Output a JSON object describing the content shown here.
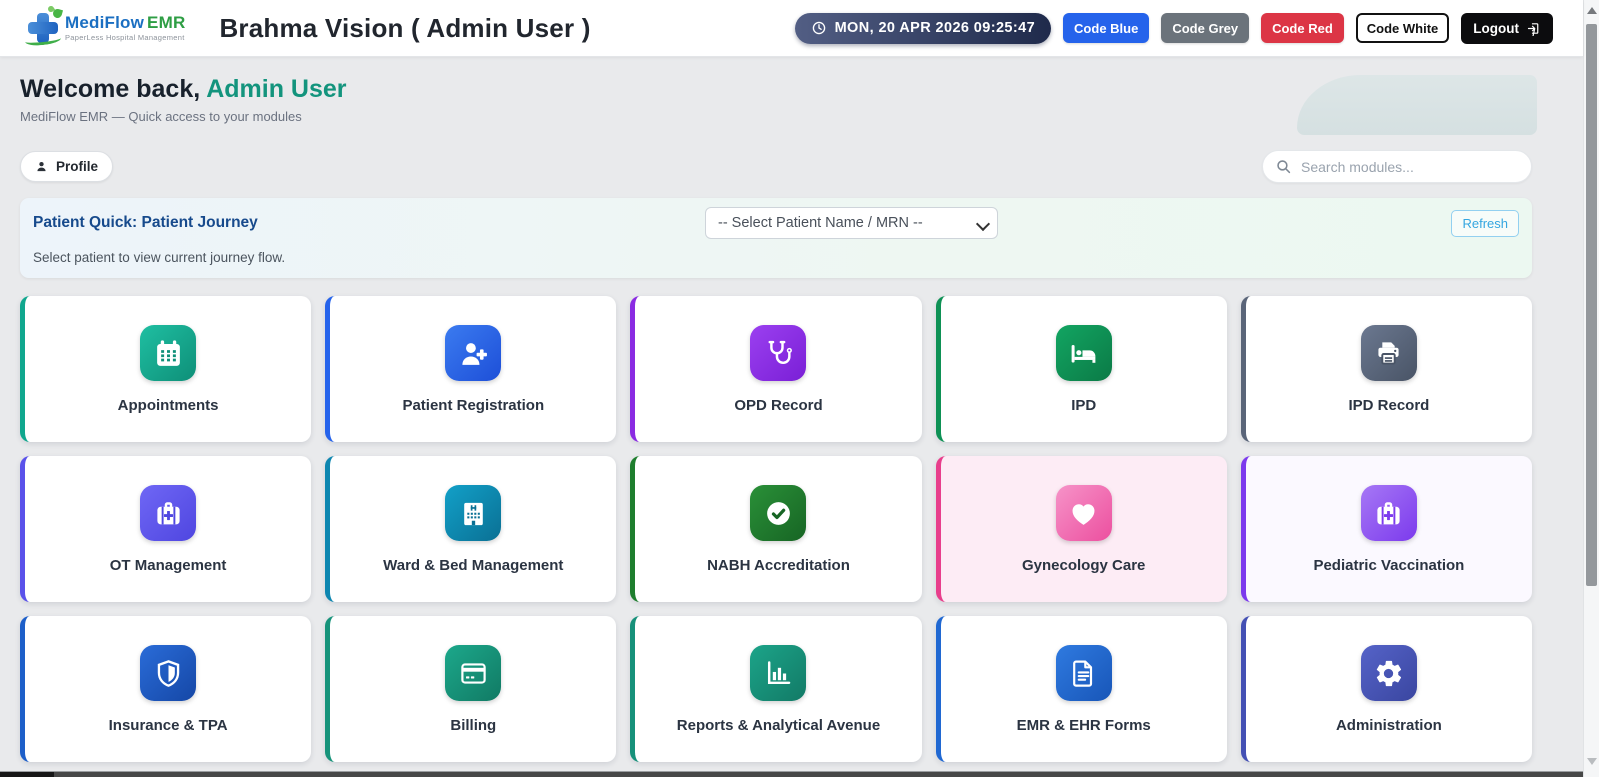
{
  "header": {
    "logo": {
      "brand_blue": "MediFlow",
      "brand_green": "EMR",
      "tagline": "PaperLess Hospital Management"
    },
    "title": "Brahma Vision ( Admin User )",
    "datetime": "MON, 20 APR 2026 09:25:47",
    "code_buttons": [
      {
        "label": "Code Blue",
        "bg": "#2563eb",
        "fg": "#ffffff"
      },
      {
        "label": "Code Grey",
        "bg": "#6b737b",
        "fg": "#ffffff"
      },
      {
        "label": "Code Red",
        "bg": "#dc3545",
        "fg": "#ffffff"
      },
      {
        "label": "Code White",
        "bg": "#ffffff",
        "fg": "#111111",
        "border": "#111111"
      }
    ],
    "logout_label": "Logout"
  },
  "welcome": {
    "greeting": "Welcome back,",
    "user": " Admin User",
    "user_color": "#13947d",
    "subtitle": "MediFlow EMR — Quick access to your modules"
  },
  "toolbar": {
    "profile_label": "Profile",
    "search_placeholder": "Search modules..."
  },
  "patient_quick": {
    "title": "Patient Quick: Patient Journey",
    "hint": "Select patient to view current journey flow.",
    "select_value": "-- Select Patient Name / MRN --",
    "refresh_label": "Refresh"
  },
  "modules": [
    {
      "label": "Appointments",
      "icon": "calendar-icon",
      "accent": "#10a78e",
      "tile_from": "#1fbfa2",
      "tile_to": "#0e8f78"
    },
    {
      "label": "Patient Registration",
      "icon": "user-plus-icon",
      "accent": "#2563eb",
      "tile_from": "#3b7bf0",
      "tile_to": "#1d4fd8"
    },
    {
      "label": "OPD Record",
      "icon": "stethoscope-icon",
      "accent": "#8a2be2",
      "tile_from": "#9b40f0",
      "tile_to": "#7a1fd6"
    },
    {
      "label": "IPD",
      "icon": "bed-icon",
      "accent": "#0e9155",
      "tile_from": "#12a562",
      "tile_to": "#0b7a46"
    },
    {
      "label": "IPD Record",
      "icon": "printer-icon",
      "accent": "#5a6579",
      "tile_from": "#6b7890",
      "tile_to": "#495466"
    },
    {
      "label": "OT Management",
      "icon": "medkit-icon",
      "accent": "#5a52ea",
      "tile_from": "#6f67f5",
      "tile_to": "#4f46e0"
    },
    {
      "label": "Ward & Bed Management",
      "icon": "hospital-icon",
      "accent": "#0d86b0",
      "tile_from": "#12a0c8",
      "tile_to": "#0a7094"
    },
    {
      "label": "NABH Accreditation",
      "icon": "check-circle-icon",
      "accent": "#1e7e2e",
      "tile_from": "#2a9038",
      "tile_to": "#176524"
    },
    {
      "label": "Gynecology Care",
      "icon": "heart-icon",
      "accent": "#e83e8c",
      "tile_from": "#f693c8",
      "tile_to": "#ec4f9f",
      "card_bg": "#fdecf5"
    },
    {
      "label": "Pediatric Vaccination",
      "icon": "medkit-icon",
      "accent": "#7c3aed",
      "tile_from": "#a678f5",
      "tile_to": "#7c3aed",
      "card_bg": "#fbf9ff"
    },
    {
      "label": "Insurance & TPA",
      "icon": "shield-icon",
      "accent": "#1d5fc9",
      "tile_from": "#2a6cd8",
      "tile_to": "#1547a6"
    },
    {
      "label": "Billing",
      "icon": "credit-card-icon",
      "accent": "#16937a",
      "tile_from": "#1ca88b",
      "tile_to": "#117a64"
    },
    {
      "label": "Reports & Analytical Avenue",
      "icon": "bar-chart-icon",
      "accent": "#17917a",
      "tile_from": "#1ca489",
      "tile_to": "#127a66"
    },
    {
      "label": "EMR & EHR Forms",
      "icon": "file-text-icon",
      "accent": "#2068d2",
      "tile_from": "#2f7ae0",
      "tile_to": "#1856b8"
    },
    {
      "label": "Administration",
      "icon": "gear-icon",
      "accent": "#4450b4",
      "tile_from": "#5563c8",
      "tile_to": "#3a46a0"
    }
  ]
}
